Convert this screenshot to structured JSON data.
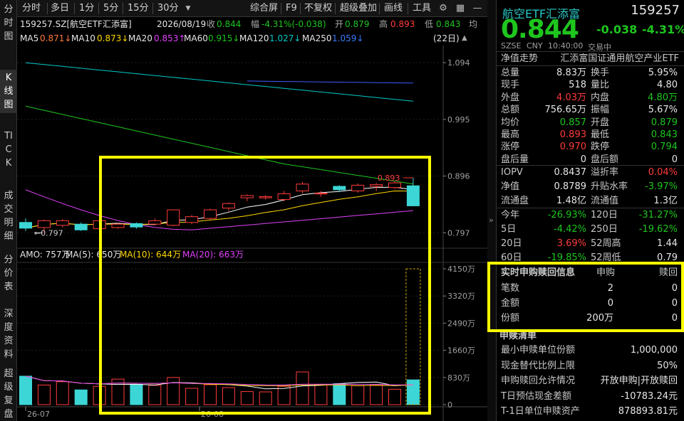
{
  "vtabs": [
    {
      "label": "分时图",
      "active": false
    },
    {
      "label": "K线图",
      "active": true
    },
    {
      "label": "TICK",
      "active": false
    },
    {
      "label": "成交明细",
      "active": false
    },
    {
      "label": "分价表",
      "active": false
    },
    {
      "label": "深度资料",
      "active": false
    },
    {
      "label": "超级复盘",
      "active": false
    }
  ],
  "toolbar": {
    "periods": [
      "分时",
      "多日",
      "1分",
      "5分",
      "15分",
      "30分"
    ],
    "dropdown_icon": "triangle-down-icon",
    "right": [
      "综合屏",
      "F9",
      "不复权",
      "超级叠加",
      "画线",
      "工具"
    ],
    "icons": [
      "gear-icon",
      "grid-icon",
      "minus-icon"
    ]
  },
  "info": {
    "code_name": "159257.SZ[航空ETF汇添富]",
    "date": "2026/08/19",
    "close_label": "收",
    "close": "0.844",
    "amp_label": "幅",
    "amp": "-4.31%(-0.038)",
    "open_label": "开",
    "open": "0.879",
    "high_label": "高",
    "high": "0.893",
    "low_label": "低",
    "low": "0.843",
    "tail": "均"
  },
  "ma": {
    "ma5_label": "MA5",
    "ma5": "0.871↓",
    "ma10_label": "MA10",
    "ma10": "0.873↓",
    "ma20_label": "MA20",
    "ma20": "0.853↑",
    "ma60_label": "MA60",
    "ma60": "0.915↓",
    "ma120_label": "MA120",
    "ma120": "1.027↓",
    "ma250_label": "MA250",
    "ma250": "1.059↓",
    "period_badge": "(22日)",
    "colors": {
      "ma5": "#ffffff",
      "ma10": "#ffd700",
      "ma20": "#e040fb",
      "ma60": "#1ec61e",
      "ma120": "#00c8c8",
      "ma250": "#3b5bff"
    }
  },
  "chart_data": {
    "type": "candlestick",
    "price_ticks": [
      "1.094",
      "0.995",
      "0.896",
      "0.797"
    ],
    "high_label": "0.893",
    "low_label": "0.797",
    "amo_line": {
      "label": "AMO: 757万",
      "ma5": "MA(5): 650万",
      "ma10": "MA(10): 644万",
      "ma20": "MA(20): 663万"
    },
    "volume_ticks": [
      "4150万",
      "3320万",
      "2490万",
      "1660万",
      "830万",
      "0"
    ],
    "date_ticks": [
      "26-07",
      "26-08"
    ],
    "candles": [
      {
        "o": 0.815,
        "c": 0.805,
        "h": 0.822,
        "l": 0.8,
        "vol": 870
      },
      {
        "o": 0.806,
        "c": 0.818,
        "h": 0.82,
        "l": 0.797,
        "vol": 600
      },
      {
        "o": 0.81,
        "c": 0.818,
        "h": 0.821,
        "l": 0.806,
        "vol": 700
      },
      {
        "o": 0.812,
        "c": 0.802,
        "h": 0.815,
        "l": 0.8,
        "vol": 450
      },
      {
        "o": 0.804,
        "c": 0.818,
        "h": 0.82,
        "l": 0.802,
        "vol": 560
      },
      {
        "o": 0.806,
        "c": 0.812,
        "h": 0.814,
        "l": 0.804,
        "vol": 780
      },
      {
        "o": 0.813,
        "c": 0.807,
        "h": 0.815,
        "l": 0.804,
        "vol": 620
      },
      {
        "o": 0.812,
        "c": 0.818,
        "h": 0.822,
        "l": 0.81,
        "vol": 590
      },
      {
        "o": 0.81,
        "c": 0.837,
        "h": 0.838,
        "l": 0.808,
        "vol": 830
      },
      {
        "o": 0.815,
        "c": 0.825,
        "h": 0.828,
        "l": 0.812,
        "vol": 500
      },
      {
        "o": 0.822,
        "c": 0.837,
        "h": 0.839,
        "l": 0.82,
        "vol": 610
      },
      {
        "o": 0.84,
        "c": 0.848,
        "h": 0.85,
        "l": 0.835,
        "vol": 520
      },
      {
        "o": 0.858,
        "c": 0.862,
        "h": 0.864,
        "l": 0.852,
        "vol": 400
      },
      {
        "o": 0.858,
        "c": 0.86,
        "h": 0.863,
        "l": 0.855,
        "vol": 390
      },
      {
        "o": 0.855,
        "c": 0.865,
        "h": 0.87,
        "l": 0.852,
        "vol": 560
      },
      {
        "o": 0.87,
        "c": 0.882,
        "h": 0.886,
        "l": 0.866,
        "vol": 1000
      },
      {
        "o": 0.865,
        "c": 0.866,
        "h": 0.87,
        "l": 0.86,
        "vol": 620
      },
      {
        "o": 0.878,
        "c": 0.872,
        "h": 0.88,
        "l": 0.868,
        "vol": 640
      },
      {
        "o": 0.87,
        "c": 0.88,
        "h": 0.883,
        "l": 0.867,
        "vol": 580
      },
      {
        "o": 0.878,
        "c": 0.881,
        "h": 0.884,
        "l": 0.87,
        "vol": 600
      },
      {
        "o": 0.876,
        "c": 0.884,
        "h": 0.887,
        "l": 0.873,
        "vol": 470
      },
      {
        "o": 0.879,
        "c": 0.844,
        "h": 0.893,
        "l": 0.843,
        "vol": 757
      }
    ],
    "colors": {
      "up": "#ff3b3b",
      "down": "#3dd6d6",
      "axis": "#8a8a8a",
      "grid": "#2a2a2a"
    }
  },
  "panel": {
    "title": "航空ETF汇添富",
    "code": "159257",
    "price": "0.844",
    "change": "-0.038",
    "change_pct": "-4.31%",
    "market": "SZSE",
    "currency": "CNY",
    "time": "10:40:00",
    "status": "交易中",
    "nav_label": "净值走势",
    "index_name": "汇添富国证通用航空产业ETF",
    "rows": [
      {
        "l1": "总量",
        "v1": "8.83万",
        "c1": "white",
        "l2": "换手",
        "v2": "5.95%",
        "c2": "white"
      },
      {
        "l1": "现手",
        "v1": "518",
        "c1": "white",
        "l2": "量比",
        "v2": "4.80",
        "c2": "white"
      },
      {
        "l1": "外盘",
        "v1": "4.03万",
        "c1": "red",
        "l2": "内盘",
        "v2": "4.80万",
        "c2": "green"
      },
      {
        "l1": "总额",
        "v1": "756.65万",
        "c1": "white",
        "l2": "振幅",
        "v2": "5.67%",
        "c2": "white"
      },
      {
        "l1": "均价",
        "v1": "0.857",
        "c1": "green",
        "l2": "开盘",
        "v2": "0.879",
        "c2": "green"
      },
      {
        "l1": "最高",
        "v1": "0.893",
        "c1": "red",
        "l2": "最低",
        "v2": "0.843",
        "c2": "green"
      },
      {
        "l1": "涨停",
        "v1": "0.970",
        "c1": "red",
        "l2": "跌停",
        "v2": "0.794",
        "c2": "green"
      },
      {
        "l1": "盘后量",
        "v1": "0",
        "c1": "white",
        "l2": "盘后额",
        "v2": "0",
        "c2": "white"
      }
    ],
    "rows2": [
      {
        "l1": "IOPV",
        "v1": "0.8437",
        "c1": "white",
        "l2": "溢折率",
        "v2": "0.04%",
        "c2": "red"
      },
      {
        "l1": "净值",
        "v1": "0.8789",
        "c1": "white",
        "l2": "升贴水率",
        "v2": "-3.97%",
        "c2": "green"
      },
      {
        "l1": "流通盘",
        "v1": "1.48亿",
        "c1": "white",
        "l2": "流通值",
        "v2": "1.3亿",
        "c2": "white"
      }
    ],
    "rows3": [
      {
        "l1": "今年",
        "v1": "-26.93%",
        "c1": "green",
        "l2": "120日",
        "v2": "-31.27%",
        "c2": "green"
      },
      {
        "l1": "5日",
        "v1": "-4.42%",
        "c1": "green",
        "l2": "250日",
        "v2": "-19.62%",
        "c2": "green"
      },
      {
        "l1": "20日",
        "v1": "3.69%",
        "c1": "red",
        "l2": "52周高",
        "v2": "1.44",
        "c2": "white"
      },
      {
        "l1": "60日",
        "v1": "-19.85%",
        "c1": "green",
        "l2": "52周低",
        "v2": "0.79",
        "c2": "white"
      }
    ],
    "subscription": {
      "title": "实时申购赎回信息",
      "col1": "申购",
      "col2": "赎回",
      "rows": [
        {
          "label": "笔数",
          "v1": "2",
          "v2": "0"
        },
        {
          "label": "金额",
          "v1": "0",
          "v2": "0"
        },
        {
          "label": "份额",
          "v1": "200万",
          "v2": "0"
        }
      ]
    },
    "list": {
      "title": "申赎清单",
      "rows": [
        {
          "label": "最小申赎单位份额",
          "value": "1,000,000"
        },
        {
          "label": "现金替代比例上限",
          "value": "50%"
        },
        {
          "label": "申购赎回允许情况",
          "value": "开放申购|开放赎回"
        },
        {
          "label": "T日预估现金差额",
          "value": "-10783.24元"
        },
        {
          "label": "T-1日单位申赎资产",
          "value": "878893.81元"
        }
      ]
    }
  }
}
